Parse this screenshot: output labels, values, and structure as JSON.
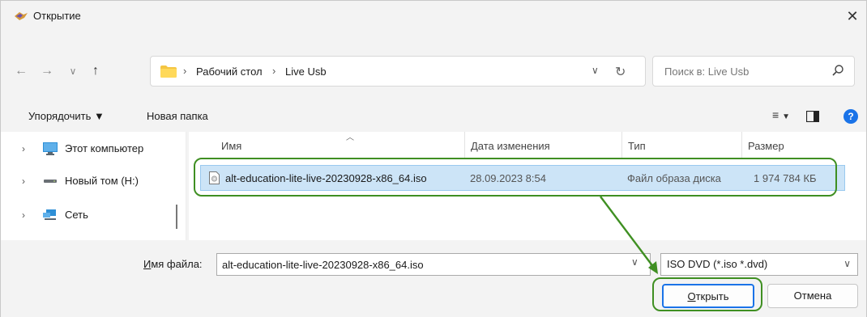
{
  "window": {
    "title": "Открытие"
  },
  "navigation": {
    "breadcrumbs": [
      "Рабочий стол",
      "Live Usb"
    ]
  },
  "search": {
    "placeholder": "Поиск в: Live Usb"
  },
  "toolbar": {
    "organize_label": "Упорядочить ▼",
    "new_folder_label": "Новая папка"
  },
  "sidebar": {
    "items": [
      {
        "label": "Этот компьютер",
        "icon": "computer-icon"
      },
      {
        "label": "Новый том (H:)",
        "icon": "drive-icon"
      },
      {
        "label": "Сеть",
        "icon": "network-icon"
      }
    ]
  },
  "file_list": {
    "columns": [
      "Имя",
      "Дата изменения",
      "Тип",
      "Размер"
    ],
    "rows": [
      {
        "name": "alt-education-lite-live-20230928-x86_64.iso",
        "date": "28.09.2023 8:54",
        "type": "Файл образа диска",
        "size": "1 974 784 КБ",
        "selected": true
      }
    ]
  },
  "footer": {
    "filename_label_underlined": "И",
    "filename_label_rest": "мя файла:",
    "filename_value": "alt-education-lite-live-20230928-x86_64.iso",
    "filetype_value": "ISO DVD (*.iso *.dvd)",
    "open_label_underlined": "О",
    "open_label_rest": "ткрыть",
    "cancel_label": "Отмена"
  },
  "colors": {
    "selection_fill": "#cce4f7",
    "annotation_green": "#3f8f22",
    "accent_blue": "#1a73e8"
  }
}
